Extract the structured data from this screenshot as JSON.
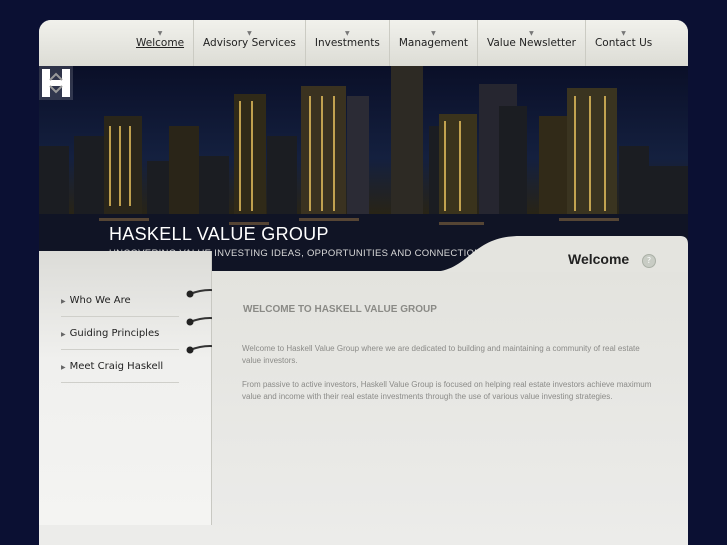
{
  "nav": {
    "items": [
      {
        "label": "Welcome",
        "active": true
      },
      {
        "label": "Advisory Services"
      },
      {
        "label": "Investments"
      },
      {
        "label": "Management"
      },
      {
        "label": "Value Newsletter"
      },
      {
        "label": "Contact Us"
      }
    ]
  },
  "banner": {
    "title": "HASKELL VALUE GROUP",
    "tagline": "UNCOVERING VALUE INVESTING IDEAS, OPPORTUNITIES AND CONNECTIONS"
  },
  "section_tab": {
    "label": "Welcome",
    "icon": "help-icon"
  },
  "sidebar": {
    "items": [
      {
        "label": "Who We Are"
      },
      {
        "label": "Guiding Principles"
      },
      {
        "label": "Meet Craig Haskell"
      }
    ]
  },
  "main": {
    "heading": "WELCOME TO HASKELL VALUE GROUP",
    "paragraphs": [
      "Welcome to Haskell Value Group where we are dedicated to building and maintaining a community of real estate value investors.",
      "From passive to active investors, Haskell Value Group is focused on helping real estate investors achieve maximum value and income with their real estate investments through the use of various value investing strategies."
    ]
  },
  "colors": {
    "page_background": "#0b1033",
    "frame": "#e9e9e4",
    "heading_gray": "#8a8a86"
  }
}
